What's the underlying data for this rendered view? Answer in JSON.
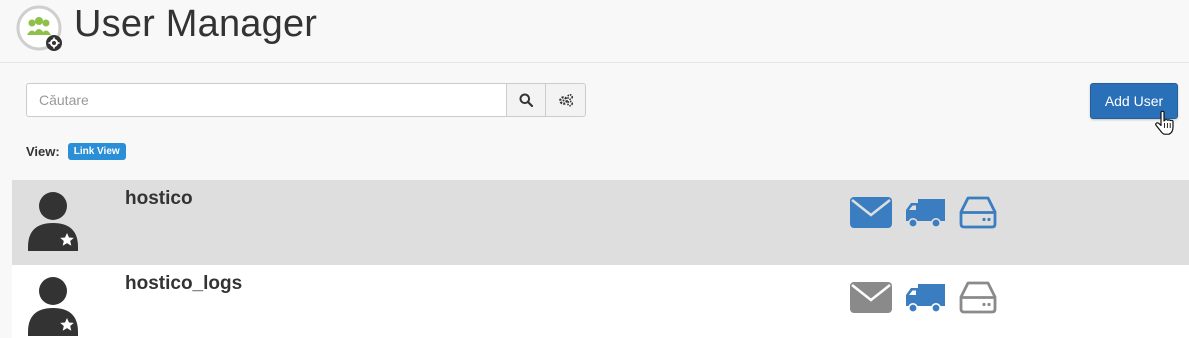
{
  "header": {
    "title": "User Manager",
    "icon": "user-manager-icon"
  },
  "search": {
    "placeholder": "Căutare",
    "value": ""
  },
  "toolbar": {
    "add_user_label": "Add User"
  },
  "view": {
    "label": "View:",
    "mode": "Link View"
  },
  "users": [
    {
      "username": "hostico",
      "email_active": true,
      "ftp_active": true,
      "webdisk_active": true
    },
    {
      "username": "hostico_logs",
      "email_active": false,
      "ftp_active": true,
      "webdisk_active": false
    }
  ],
  "colors": {
    "primary": "#2a70b8",
    "active_service": "#3a7dc0",
    "inactive_service": "#8a8a8a",
    "badge": "#2a8fd6"
  }
}
